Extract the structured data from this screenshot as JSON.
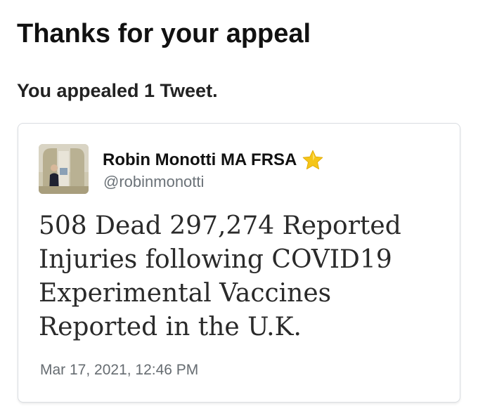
{
  "page": {
    "title": "Thanks for your appeal",
    "subtitle": "You appealed 1 Tweet."
  },
  "tweet": {
    "author_name": "Robin Monotti MA FRSA",
    "author_badge_icon": "star-icon",
    "handle": "@robinmonotti",
    "text_lines": [
      "508 Dead 297,274 Reported",
      "Injuries following COVID19",
      "Experimental Vaccines",
      "Reported in the U.K."
    ],
    "timestamp": "Mar 17, 2021, 12:46 PM"
  },
  "colors": {
    "star": "#f5c518",
    "handle_gray": "#6b7278",
    "card_border": "#d9dde1"
  }
}
